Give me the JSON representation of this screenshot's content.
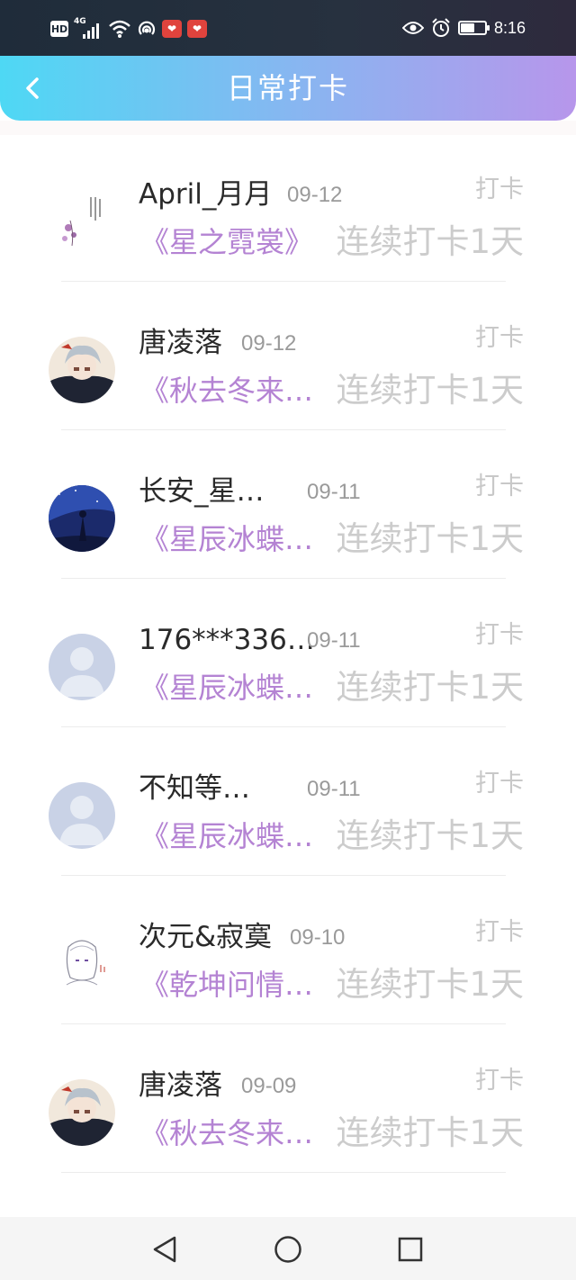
{
  "status_bar": {
    "hd": "HD",
    "network": "4G",
    "time": "8:16",
    "battery_level": 0.55,
    "icons": [
      "hd-icon",
      "signal-icon",
      "wifi-icon",
      "hotspot-icon",
      "app-notification-icon",
      "app-notification-icon",
      "eye-icon",
      "alarm-icon",
      "battery-icon"
    ]
  },
  "header": {
    "title": "日常打卡",
    "back_icon": "chevron-left-icon",
    "gradient": [
      "#4ed8f4",
      "#b796eb"
    ]
  },
  "list": [
    {
      "username": "April_月月",
      "date": "09-12",
      "type": "打卡",
      "book": "《星之霓裳》",
      "streak": "连续打卡1天",
      "avatar": "artwork-avatar"
    },
    {
      "username": "唐凌落",
      "date": "09-12",
      "type": "打卡",
      "book": "《秋去冬来…",
      "streak": "连续打卡1天",
      "avatar": "anime-avatar"
    },
    {
      "username": "长安_星…",
      "date": "09-11",
      "type": "打卡",
      "book": "《星辰冰蝶…",
      "streak": "连续打卡1天",
      "avatar": "night-sky-avatar"
    },
    {
      "username": "176***336…",
      "date": "09-11",
      "type": "打卡",
      "book": "《星辰冰蝶…",
      "streak": "连续打卡1天",
      "avatar": "default-avatar"
    },
    {
      "username": "不知等…",
      "date": "09-11",
      "type": "打卡",
      "book": "《星辰冰蝶…",
      "streak": "连续打卡1天",
      "avatar": "default-avatar"
    },
    {
      "username": "次元&寂寞",
      "date": "09-10",
      "type": "打卡",
      "book": "《乾坤问情…",
      "streak": "连续打卡1天",
      "avatar": "sketch-avatar"
    },
    {
      "username": "唐凌落",
      "date": "09-09",
      "type": "打卡",
      "book": "《秋去冬来…",
      "streak": "连续打卡1天",
      "avatar": "anime-avatar"
    }
  ],
  "colors": {
    "book_title": "#b483d3",
    "streak": "#cccccc",
    "date": "#9a9a9a",
    "username": "#2a2a2a"
  },
  "nav_bar": {
    "icons": [
      "back-triangle-icon",
      "home-circle-icon",
      "recents-square-icon"
    ]
  }
}
